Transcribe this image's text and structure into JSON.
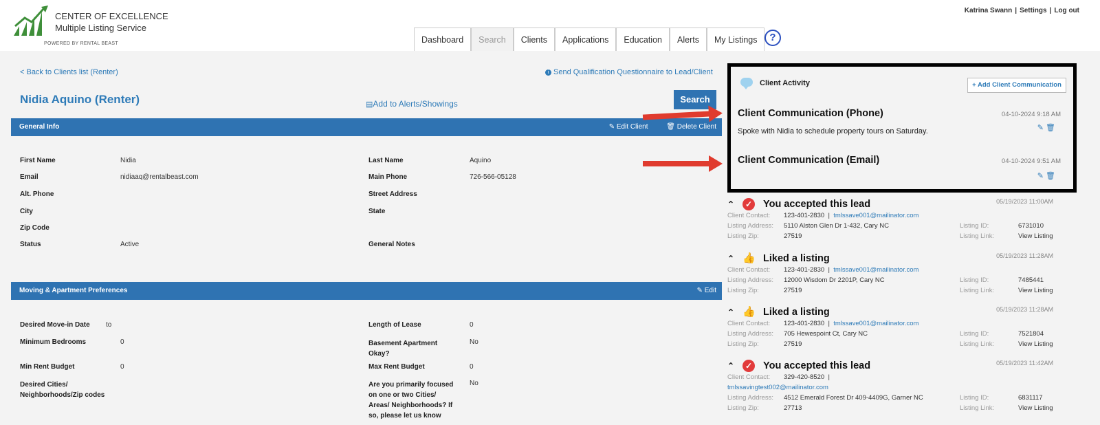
{
  "brand": {
    "line1": "CENTER OF EXCELLENCE",
    "line2": "Multiple Listing Service",
    "powered": "POWERED BY RENTAL BEAST",
    "colors": {
      "green": "#3f8f3a",
      "blue": "#2f73b2",
      "red": "#e03b2e"
    }
  },
  "user": {
    "name": "Katrina Swann",
    "settings": "Settings",
    "logout": "Log out",
    "sep": "|"
  },
  "tabs": [
    "Dashboard",
    "Search",
    "Clients",
    "Applications",
    "Education",
    "Alerts",
    "My Listings"
  ],
  "active_tab": "Search",
  "help_icon": "?",
  "back_link": "< Back to Clients list (Renter)",
  "questionnaire_link": "Send Qualification Questionnaire to Lead/Client",
  "client_title": "Nidia Aquino (Renter)",
  "alerts_link": "Add to Alerts/Showings",
  "search_button": "Search",
  "general": {
    "title": "General Info",
    "edit": "Edit Client",
    "delete": "Delete Client",
    "first_name_label": "First Name",
    "first_name": "Nidia",
    "last_name_label": "Last Name",
    "last_name": "Aquino",
    "email_label": "Email",
    "email": "nidiaaq@rentalbeast.com",
    "main_phone_label": "Main Phone",
    "main_phone": "726-566-05128",
    "alt_phone_label": "Alt. Phone",
    "street_label": "Street Address",
    "city_label": "City",
    "state_label": "State",
    "zip_label": "Zip Code",
    "status_label": "Status",
    "status": "Active",
    "notes_label": "General Notes"
  },
  "prefs": {
    "title": "Moving & Apartment Preferences",
    "edit": "Edit",
    "move_in_label": "Desired Move-in Date",
    "move_in_to": "to",
    "lease_label": "Length of Lease",
    "lease": "0",
    "min_bed_label": "Minimum Bedrooms",
    "min_bed": "0",
    "basement_label1": "Basement Apartment",
    "basement_label2": "Okay?",
    "basement": "No",
    "min_rent_label": "Min Rent Budget",
    "min_rent": "0",
    "max_rent_label": "Max Rent Budget",
    "max_rent": "0",
    "cities_label1": "Desired Cities/",
    "cities_label2": "Neighborhoods/Zip codes",
    "focus_label1": "Are you primarily focused",
    "focus_label2": "on one or two Cities/",
    "focus_label3": "Areas/ Neighborhoods? If",
    "focus_label4": "so, please let us know",
    "focus": "No"
  },
  "activity": {
    "title": "Client Activity",
    "add": "+ Add Client Communication",
    "comms": [
      {
        "title": "Client Communication (Phone)",
        "date": "04-10-2024 9:18 AM",
        "body": "Spoke with Nidia to schedule property tours on Saturday."
      },
      {
        "title": "Client Communication (Email)",
        "date": "04-10-2024 9:51 AM",
        "body": ""
      }
    ],
    "labels": {
      "contact": "Client Contact:",
      "address": "Listing Address:",
      "zip": "Listing Zip:",
      "id": "Listing ID:",
      "link": "Listing Link:",
      "view": "View Listing"
    },
    "items": [
      {
        "type": "check",
        "title": "You accepted this lead",
        "date": "05/19/2023 11:00AM",
        "phone": "123-401-2830",
        "email": "tmlssave001@mailinator.com",
        "address": "5110 Alston Glen Dr 1-432, Cary NC",
        "zip": "27519",
        "id": "6731010"
      },
      {
        "type": "thumb",
        "title": "Liked a listing",
        "date": "05/19/2023 11:28AM",
        "phone": "123-401-2830",
        "email": "tmlssave001@mailinator.com",
        "address": "12000 Wisdom Dr 2201P, Cary NC",
        "zip": "27519",
        "id": "7485441"
      },
      {
        "type": "thumb",
        "title": "Liked a listing",
        "date": "05/19/2023 11:28AM",
        "phone": "123-401-2830",
        "email": "tmlssave001@mailinator.com",
        "address": "705 Hewespoint Ct, Cary NC",
        "zip": "27519",
        "id": "7521804"
      },
      {
        "type": "check",
        "title": "You accepted this lead",
        "date": "05/19/2023 11:42AM",
        "phone": "329-420-8520",
        "email": "tmlssavingtest002@mailinator.com",
        "address": "4512 Emerald Forest Dr 409-4409G, Garner NC",
        "zip": "27713",
        "id": "6831117"
      }
    ]
  }
}
